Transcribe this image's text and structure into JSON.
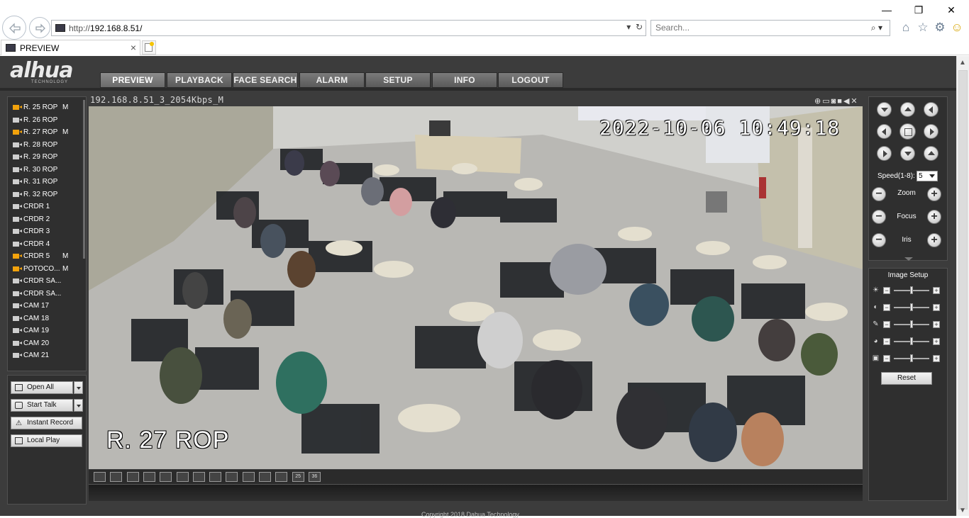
{
  "browser": {
    "url_protocol": "http://",
    "url_host": "192.168.8.51/",
    "search_placeholder": "Search...",
    "tab_title": "PREVIEW"
  },
  "app": {
    "brand": "alhua",
    "brand_sub": "TECHNOLOGY",
    "nav": [
      "PREVIEW",
      "PLAYBACK",
      "FACE SEARCH",
      "ALARM",
      "SETUP",
      "INFO",
      "LOGOUT"
    ],
    "active_nav": "PREVIEW"
  },
  "channels": [
    {
      "label": "R. 25 ROP",
      "mark": "M",
      "live": true
    },
    {
      "label": "R. 26 ROP",
      "mark": "",
      "live": false
    },
    {
      "label": "R. 27 ROP",
      "mark": "M",
      "live": true
    },
    {
      "label": "R. 28 ROP",
      "mark": "",
      "live": false
    },
    {
      "label": "R. 29 ROP",
      "mark": "",
      "live": false
    },
    {
      "label": "R. 30 ROP",
      "mark": "",
      "live": false
    },
    {
      "label": "R. 31 ROP",
      "mark": "",
      "live": false
    },
    {
      "label": "R. 32 ROP",
      "mark": "",
      "live": false
    },
    {
      "label": "CRDR 1",
      "mark": "",
      "live": false
    },
    {
      "label": "CRDR 2",
      "mark": "",
      "live": false
    },
    {
      "label": "CRDR 3",
      "mark": "",
      "live": false
    },
    {
      "label": "CRDR 4",
      "mark": "",
      "live": false
    },
    {
      "label": "CRDR 5",
      "mark": "M",
      "live": true
    },
    {
      "label": "POTOCO...",
      "mark": "M",
      "live": true
    },
    {
      "label": "CRDR SA...",
      "mark": "",
      "live": false
    },
    {
      "label": "CRDR SA...",
      "mark": "",
      "live": false
    },
    {
      "label": "CAM 17",
      "mark": "",
      "live": false
    },
    {
      "label": "CAM 18",
      "mark": "",
      "live": false
    },
    {
      "label": "CAM 19",
      "mark": "",
      "live": false
    },
    {
      "label": "CAM 20",
      "mark": "",
      "live": false
    },
    {
      "label": "CAM 21",
      "mark": "",
      "live": false
    }
  ],
  "actions": {
    "open_all": "Open All",
    "start_talk": "Start Talk",
    "instant_record": "Instant Record",
    "local_play": "Local Play"
  },
  "video": {
    "stream_title": "192.168.8.51_3_2054Kbps_M",
    "osd_time": "2022-10-06 10:49:18",
    "osd_name": "R. 27 ROP"
  },
  "layout_buttons": [
    "",
    "",
    "",
    "",
    "",
    "",
    "",
    "",
    "",
    "",
    "",
    "",
    "25",
    "36"
  ],
  "ptz": {
    "speed_label": "Speed(1-8):",
    "speed_value": "5",
    "zoom": "Zoom",
    "focus": "Focus",
    "iris": "Iris"
  },
  "image_setup": {
    "title": "Image Setup",
    "sliders": [
      {
        "name": "brightness",
        "icon": "sun-icon",
        "level": 0.5
      },
      {
        "name": "contrast",
        "icon": "contrast-icon",
        "level": 0.5
      },
      {
        "name": "saturation",
        "icon": "saturation-icon",
        "level": 0.5
      },
      {
        "name": "hue",
        "icon": "hue-icon",
        "level": 0.5
      },
      {
        "name": "gain",
        "icon": "gain-icon",
        "level": 0.5
      }
    ],
    "reset": "Reset"
  },
  "footer": "Copyright 2018 Dahua Technology"
}
